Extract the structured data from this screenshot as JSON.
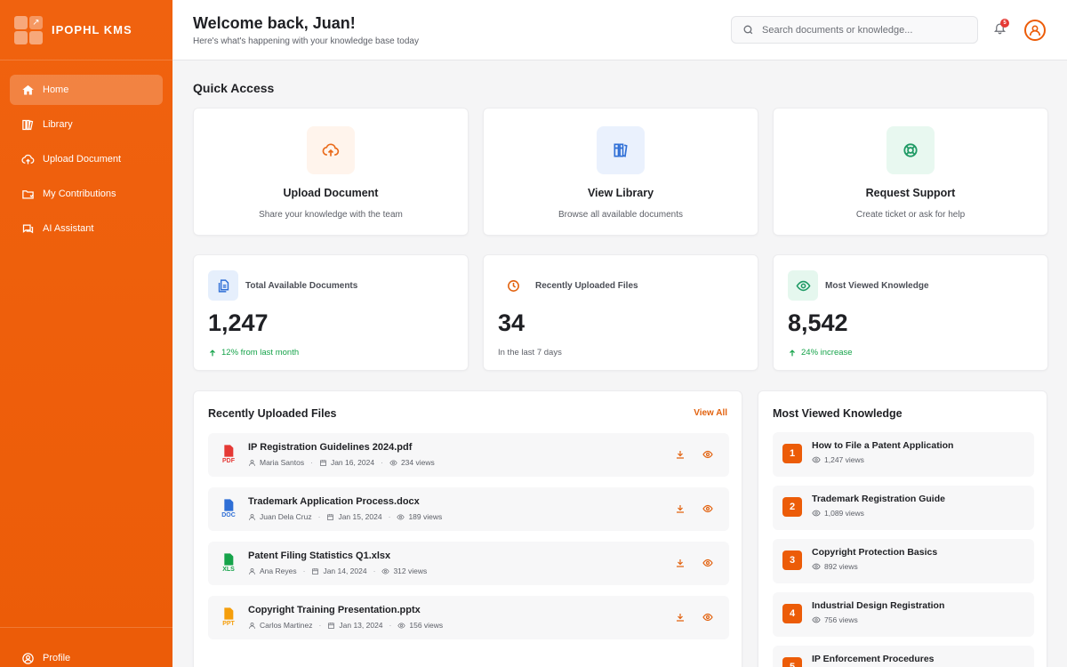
{
  "brand": {
    "name": "IPOPHL KMS"
  },
  "sidebar": {
    "items": [
      {
        "label": "Home",
        "icon": "home-icon",
        "active": true
      },
      {
        "label": "Library",
        "icon": "library-icon",
        "active": false
      },
      {
        "label": "Upload Document",
        "icon": "upload-icon",
        "active": false
      },
      {
        "label": "My Contributions",
        "icon": "folder-icon",
        "active": false
      },
      {
        "label": "AI Assistant",
        "icon": "chat-icon",
        "active": false
      }
    ],
    "profile_label": "Profile"
  },
  "header": {
    "title": "Welcome back, Juan!",
    "subtitle": "Here's what's happening with your knowledge base today",
    "search_placeholder": "Search documents or knowledge...",
    "notification_count": "5"
  },
  "quick_access": {
    "title": "Quick Access",
    "cards": [
      {
        "title": "Upload Document",
        "desc": "Share your knowledge with the team",
        "icon": "cloud-upload-icon",
        "color": "#ea6a1a",
        "bg": "#fff4ec"
      },
      {
        "title": "View Library",
        "desc": "Browse all available documents",
        "icon": "books-icon",
        "color": "#2f6fd6",
        "bg": "#eaf1fd"
      },
      {
        "title": "Request Support",
        "desc": "Create ticket or ask for help",
        "icon": "lifebuoy-icon",
        "color": "#1f9a65",
        "bg": "#e8f8f0"
      }
    ]
  },
  "stats": [
    {
      "label": "Total Available Documents",
      "value": "1,247",
      "foot": "12% from last month",
      "trend": "up",
      "icon": "documents-icon",
      "color": "#2f6fd6",
      "bg": "#e6effc"
    },
    {
      "label": "Recently Uploaded Files",
      "value": "34",
      "foot": "In the last 7 days",
      "trend": "none",
      "icon": "clock-icon",
      "color": "#e2620f",
      "bg": "#ffffff"
    },
    {
      "label": "Most Viewed Knowledge",
      "value": "8,542",
      "foot": "24% increase",
      "trend": "up",
      "icon": "eye-icon",
      "color": "#1f9a65",
      "bg": "#e5f7ee"
    }
  ],
  "recent_files": {
    "title": "Recently Uploaded Files",
    "view_all": "View All",
    "items": [
      {
        "name": "IP Registration Guidelines 2024.pdf",
        "type": "PDF",
        "type_color": "#e53935",
        "author": "Maria Santos",
        "date": "Jan 16, 2024",
        "views": "234 views"
      },
      {
        "name": "Trademark Application Process.docx",
        "type": "DOC",
        "type_color": "#2f6fd6",
        "author": "Juan Dela Cruz",
        "date": "Jan 15, 2024",
        "views": "189 views"
      },
      {
        "name": "Patent Filing Statistics Q1.xlsx",
        "type": "XLS",
        "type_color": "#16a34a",
        "author": "Ana Reyes",
        "date": "Jan 14, 2024",
        "views": "312 views"
      },
      {
        "name": "Copyright Training Presentation.pptx",
        "type": "PPT",
        "type_color": "#f59e0b",
        "author": "Carlos Martinez",
        "date": "Jan 13, 2024",
        "views": "156 views"
      }
    ]
  },
  "most_viewed": {
    "title": "Most Viewed Knowledge",
    "items": [
      {
        "rank": "1",
        "title": "How to File a Patent Application",
        "views": "1,247 views"
      },
      {
        "rank": "2",
        "title": "Trademark Registration Guide",
        "views": "1,089 views"
      },
      {
        "rank": "3",
        "title": "Copyright Protection Basics",
        "views": "892 views"
      },
      {
        "rank": "4",
        "title": "Industrial Design Registration",
        "views": "756 views"
      },
      {
        "rank": "5",
        "title": "IP Enforcement Procedures",
        "views": ""
      }
    ]
  }
}
